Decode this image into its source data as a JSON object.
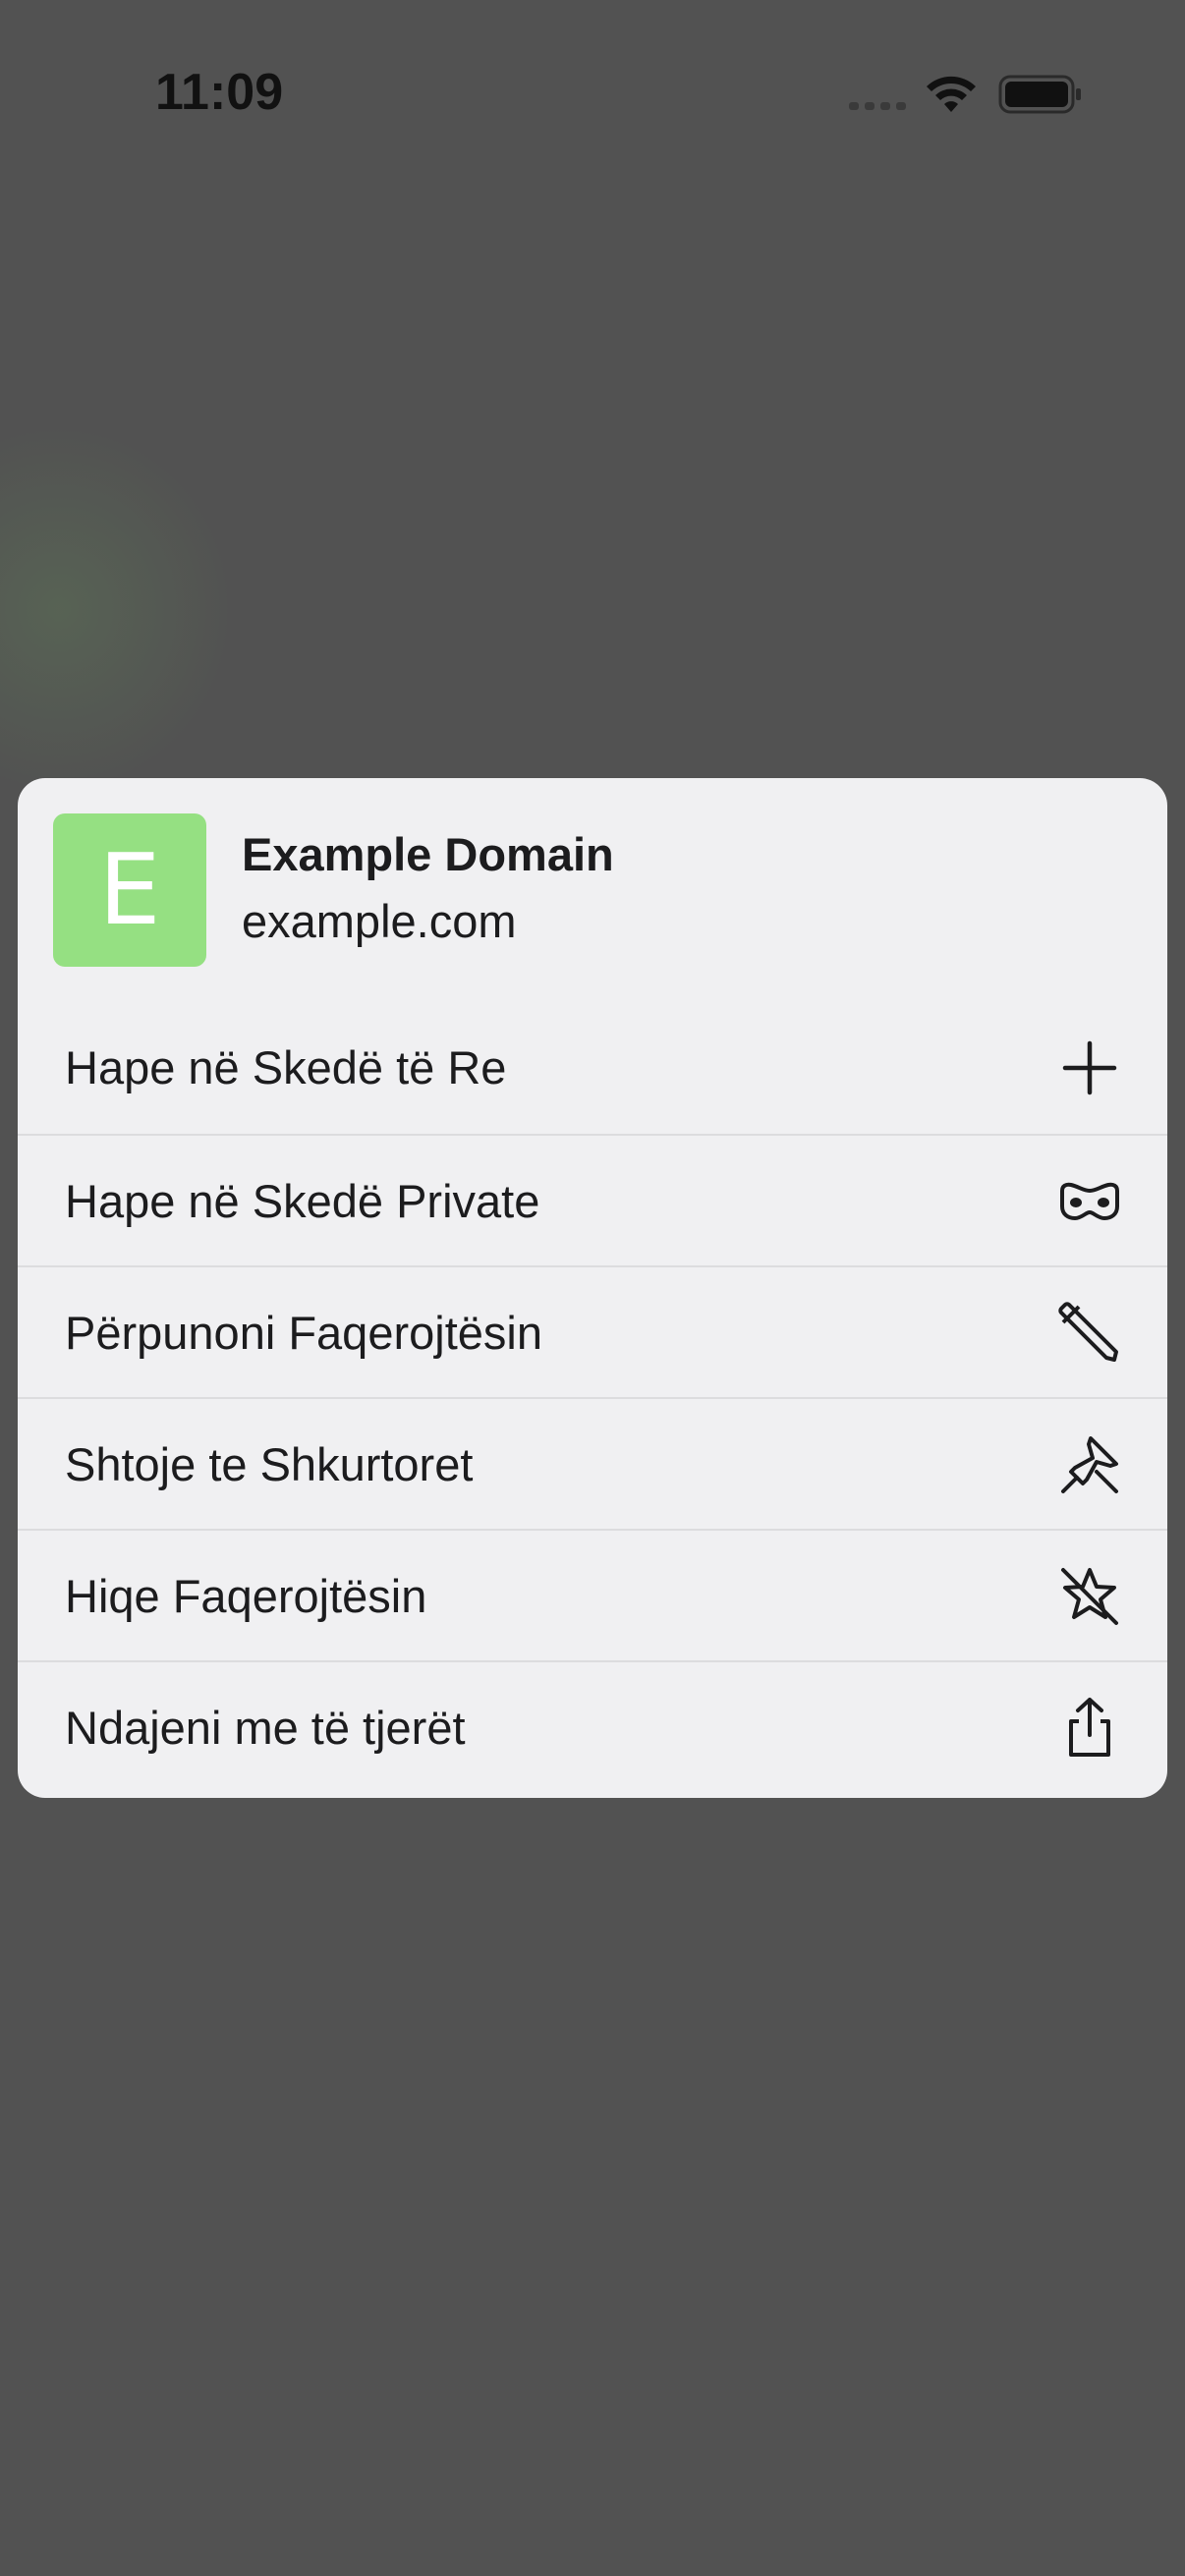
{
  "status_bar": {
    "time": "11:09",
    "icons": [
      "signal-icon",
      "wifi-icon",
      "battery-icon"
    ]
  },
  "context_menu": {
    "header": {
      "favicon_letter": "E",
      "favicon_color": "#95e082",
      "title": "Example Domain",
      "url": "example.com"
    },
    "items": [
      {
        "label": "Hape në Skedë të Re",
        "icon": "plus-icon"
      },
      {
        "label": "Hape në Skedë Private",
        "icon": "private-mask-icon"
      },
      {
        "label": "Përpunoni Faqerojtësin",
        "icon": "pencil-icon"
      },
      {
        "label": "Shtoje te Shkurtoret",
        "icon": "pin-icon"
      },
      {
        "label": "Hiqe Faqerojtësin",
        "icon": "star-slash-icon"
      },
      {
        "label": "Ndajeni me të tjerët",
        "icon": "share-icon"
      }
    ]
  },
  "colors": {
    "backdrop": "#525252",
    "menu_background": "#f0f0f2",
    "text": "#1c1c1e",
    "divider": "#dcdcde"
  }
}
